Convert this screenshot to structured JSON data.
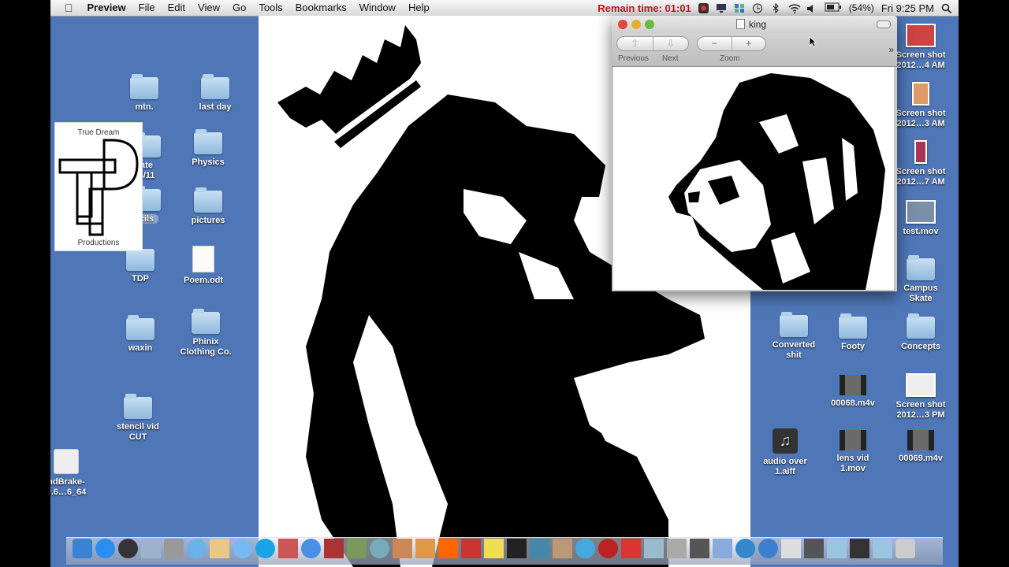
{
  "menubar": {
    "apple": "",
    "app": "Preview",
    "items": [
      "File",
      "Edit",
      "View",
      "Go",
      "Tools",
      "Bookmarks",
      "Window",
      "Help"
    ],
    "remain_time": "Remain time: 01:01",
    "battery": "(54%)",
    "clock": "Fri 9:25 PM"
  },
  "desktop": {
    "left_icons": [
      {
        "label": "mtn.",
        "kind": "folder"
      },
      {
        "label": "last day",
        "kind": "folder"
      },
      {
        "label": "ate\n4/11",
        "kind": "folder"
      },
      {
        "label": "Physics",
        "kind": "folder"
      },
      {
        "label": "cils",
        "kind": "folder"
      },
      {
        "label": "pictures",
        "kind": "folder"
      },
      {
        "label": "TDP",
        "kind": "folder"
      },
      {
        "label": "Poem.odt",
        "kind": "document"
      },
      {
        "label": "waxin",
        "kind": "folder"
      },
      {
        "label": "Phinix\nClothing Co.",
        "kind": "folder"
      },
      {
        "label": "stencil vid\nCUT",
        "kind": "folder"
      },
      {
        "label": "ndBrake-\n9.6…6_64",
        "kind": "disk"
      }
    ],
    "right_icons": [
      {
        "label": "Screen shot\n2012…4 AM",
        "kind": "thumbnail"
      },
      {
        "label": "Screen shot\n2012…3 AM",
        "kind": "thumbnail"
      },
      {
        "label": "Screen shot\n2012…7 AM",
        "kind": "thumbnail"
      },
      {
        "label": "test.mov",
        "kind": "thumbnail"
      },
      {
        "label": "Campus\nSkate",
        "kind": "folder"
      },
      {
        "label": "Converted\nshit",
        "kind": "folder"
      },
      {
        "label": "Footy",
        "kind": "folder"
      },
      {
        "label": "Concepts",
        "kind": "folder"
      },
      {
        "label": "00068.m4v",
        "kind": "film"
      },
      {
        "label": "Screen shot\n2012…3 PM",
        "kind": "thumbnail"
      },
      {
        "label": "audio over\n1.aiff",
        "kind": "music"
      },
      {
        "label": "lens vid\n1.mov",
        "kind": "film"
      },
      {
        "label": "00069.m4v",
        "kind": "film"
      }
    ],
    "tdp_logo": {
      "top": "True Dream",
      "bottom": "Productions"
    }
  },
  "preview": {
    "title": "king",
    "prev_label": "Previous",
    "next_label": "Next",
    "zoom_label": "Zoom",
    "zoom_out": "−",
    "zoom_in": "+",
    "more": "»"
  }
}
